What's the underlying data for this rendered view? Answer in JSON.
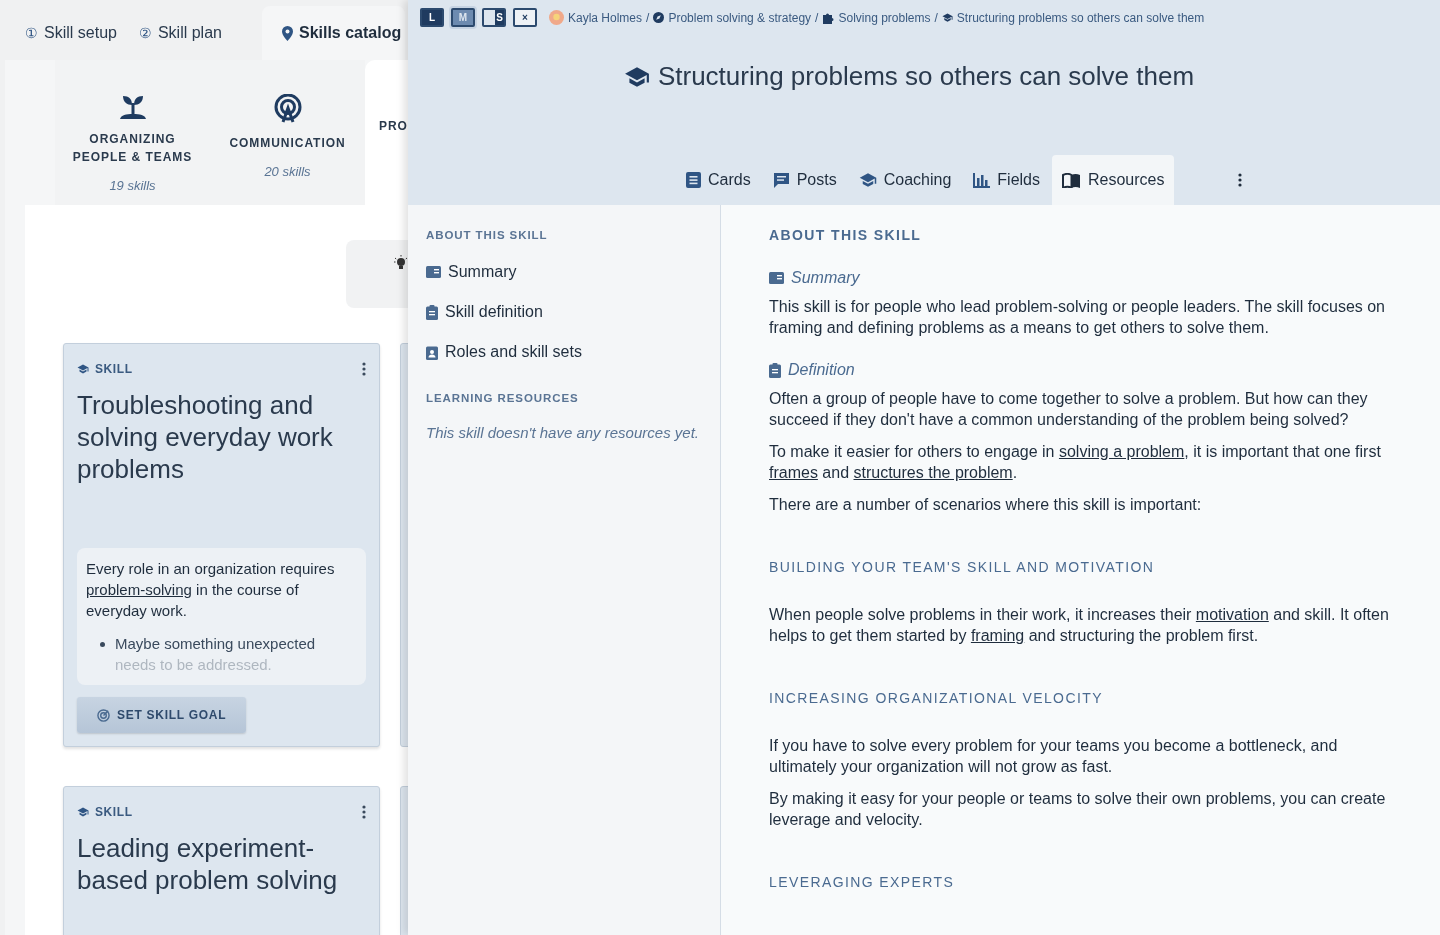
{
  "catalog": {
    "tabs": [
      {
        "number": "①",
        "label": "Skill setup",
        "selected": false
      },
      {
        "number": "②",
        "label": "Skill plan",
        "selected": false
      },
      {
        "label": "Skills catalog",
        "selected": true
      }
    ],
    "categories": [
      {
        "name": "ORGANIZING PEOPLE & TEAMS",
        "count": "19 skills",
        "selected": false
      },
      {
        "name": "COMMUNICATION",
        "count": "20 skills",
        "selected": false
      },
      {
        "name": "PRO",
        "selected": true
      }
    ],
    "cards": [
      {
        "tag": "SKILL",
        "title": "Troubleshooting and solving everyday work problems",
        "quote": [
          {
            "text": "Every role in an organization requires "
          },
          {
            "text": "problem-solving",
            "link": true
          },
          {
            "text": " in the course of everyday work."
          }
        ],
        "bullets": [
          "Maybe something unexpected needs to be addressed."
        ],
        "button": "SET SKILL GOAL"
      },
      {
        "tag": "SKILL",
        "title": "Leading experiment-based problem solving"
      }
    ]
  },
  "panel": {
    "size_buttons": [
      {
        "label": "L",
        "selected": false,
        "kind": "filled"
      },
      {
        "label": "M",
        "selected": true,
        "kind": "filled"
      },
      {
        "label": "S",
        "selected": false,
        "kind": "side"
      },
      {
        "label": "×",
        "selected": false,
        "kind": "outline"
      }
    ],
    "breadcrumb": [
      {
        "text": "Kayla Holmes"
      },
      {
        "separator": "/",
        "text": "Problem solving & strategy"
      },
      {
        "separator": "/",
        "text": "Solving problems"
      },
      {
        "separator": "/",
        "text": "Structuring problems so others can solve them"
      }
    ],
    "title": "Structuring problems so others can solve them",
    "tabs": [
      {
        "label": "Cards",
        "selected": false
      },
      {
        "label": "Posts",
        "selected": false
      },
      {
        "label": "Coaching",
        "selected": false
      },
      {
        "label": "Fields",
        "selected": false
      },
      {
        "label": "Resources",
        "selected": true
      }
    ],
    "nav": [
      {
        "heading": "ABOUT THIS SKILL",
        "items": [
          "Summary",
          "Skill definition",
          "Roles and skill sets"
        ]
      },
      {
        "heading": "LEARNING RESOURCES",
        "empty": "This skill doesn't have any resources yet."
      }
    ],
    "sections": [
      {
        "heading": "ABOUT THIS SKILL",
        "blocks": [
          {
            "kind": "subheading",
            "text": "Summary"
          },
          {
            "kind": "paragraph",
            "parts": [
              {
                "text": "This skill is for people who lead problem-solving or people leaders. The skill focuses on framing and defining problems as a means to get others to solve them."
              }
            ]
          },
          {
            "kind": "subheading",
            "text": "Definition"
          },
          {
            "kind": "paragraph",
            "parts": [
              {
                "text": "Often a group of people have to come together to solve a problem.  But how can they succeed if they don't have a common understanding of the problem being solved?"
              }
            ]
          },
          {
            "kind": "paragraph",
            "parts": [
              {
                "text": "To make it easier for others to engage in "
              },
              {
                "text": "solving a problem",
                "link": true
              },
              {
                "text": ", it is important that one first "
              },
              {
                "text": "frames",
                "link": true
              },
              {
                "text": " and "
              },
              {
                "text": "structures the problem",
                "link": true
              },
              {
                "text": "."
              }
            ]
          },
          {
            "kind": "paragraph",
            "parts": [
              {
                "text": "There are a number of scenarios where this skill is important:"
              }
            ]
          }
        ]
      },
      {
        "heading": "BUILDING YOUR TEAM'S SKILL AND MOTIVATION",
        "blocks": [
          {
            "kind": "paragraph",
            "parts": [
              {
                "text": "When people solve problems in their work, it increases their "
              },
              {
                "text": "motivation",
                "link": true
              },
              {
                "text": " and skill.  It often helps to get them started by "
              },
              {
                "text": "framing",
                "link": true
              },
              {
                "text": " and structuring the problem first."
              }
            ]
          }
        ]
      },
      {
        "heading": "INCREASING ORGANIZATIONAL VELOCITY",
        "blocks": [
          {
            "kind": "paragraph",
            "parts": [
              {
                "text": "If you have to solve every problem for your teams you become a bottleneck, and ultimately your organization will not grow as fast."
              }
            ]
          },
          {
            "kind": "paragraph",
            "parts": [
              {
                "text": "By making it easy for your people or teams to solve their own problems, you can create leverage and velocity."
              }
            ]
          }
        ]
      },
      {
        "heading": "LEVERAGING EXPERTS"
      }
    ]
  }
}
